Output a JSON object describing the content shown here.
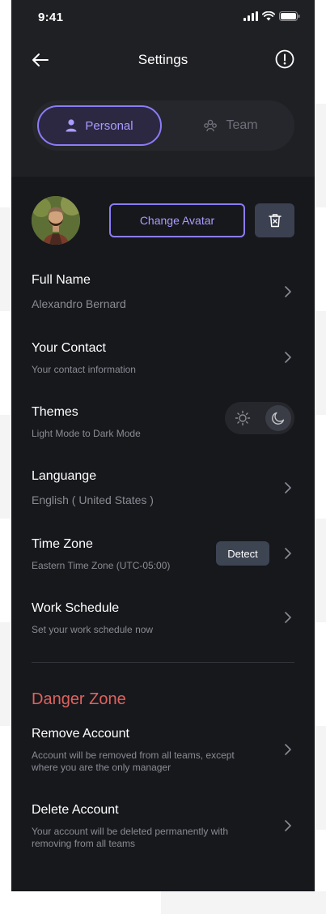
{
  "status_bar": {
    "time": "9:41"
  },
  "header": {
    "title": "Settings"
  },
  "segments": [
    {
      "label": "Personal",
      "active": true
    },
    {
      "label": "Team",
      "active": false
    }
  ],
  "avatar": {
    "change_label": "Change Avatar"
  },
  "settings": {
    "full_name": {
      "title": "Full Name",
      "value": "Alexandro Bernard"
    },
    "contact": {
      "title": "Your Contact",
      "value": "Your contact information"
    },
    "themes": {
      "title": "Themes",
      "value": "Light Mode to Dark Mode",
      "mode": "dark"
    },
    "language": {
      "title": "Languange",
      "value": "English ( United States )"
    },
    "time_zone": {
      "title": "Time Zone",
      "value": "Eastern Time Zone (UTC-05:00)",
      "detect_label": "Detect"
    },
    "work_schedule": {
      "title": "Work Schedule",
      "value": "Set your work schedule now"
    }
  },
  "danger_zone": {
    "title": "Danger Zone",
    "remove_account": {
      "title": "Remove Account",
      "value": "Account will be removed from all teams, except where you are the only manager"
    },
    "delete_account": {
      "title": "Delete Account",
      "value": "Your account will be deleted permanently with removing from all teams"
    }
  },
  "colors": {
    "accent": "#8b7cf6",
    "danger": "#e0625e",
    "background": "#17181c",
    "header_background": "#1f2024"
  },
  "icons": {
    "back": "arrow-left-icon",
    "info": "info-circle-icon",
    "personal": "user-icon",
    "team": "team-icon",
    "delete": "trash-icon",
    "chevron": "chevron-right-icon",
    "sun": "sun-icon",
    "moon": "moon-icon"
  }
}
